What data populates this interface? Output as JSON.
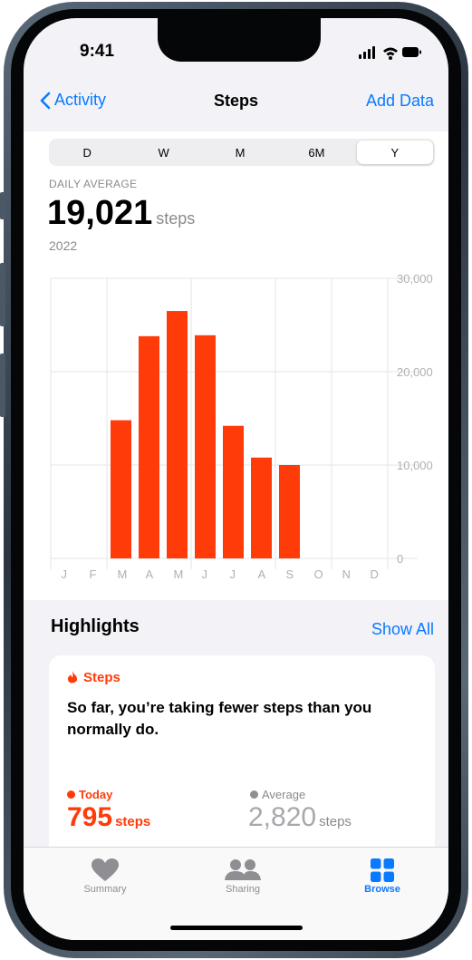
{
  "status_bar": {
    "time": "9:41"
  },
  "nav": {
    "back_label": "Activity",
    "title": "Steps",
    "add_label": "Add Data"
  },
  "segments": {
    "d": "D",
    "w": "W",
    "m": "M",
    "six_m": "6M",
    "y": "Y",
    "selected": "Y"
  },
  "summary": {
    "label": "DAILY AVERAGE",
    "value": "19,021",
    "unit": "steps",
    "period": "2022"
  },
  "chart_data": {
    "type": "bar",
    "categories": [
      "J",
      "F",
      "M",
      "A",
      "M",
      "J",
      "J",
      "A",
      "S",
      "O",
      "N",
      "D"
    ],
    "values": [
      0,
      0,
      14800,
      23800,
      26500,
      23900,
      14200,
      10800,
      10000,
      0,
      0,
      0
    ],
    "y_ticks": [
      "30,000",
      "20,000",
      "10,000",
      "0"
    ],
    "ylim": [
      0,
      30000
    ],
    "color": "#ff3b0a",
    "grid": true
  },
  "highlights": {
    "title": "Highlights",
    "show_all": "Show All",
    "card": {
      "category": "Steps",
      "text": "So far, you’re taking fewer steps than you normally do.",
      "today_label": "Today",
      "today_value": "795",
      "today_unit": "steps",
      "average_label": "Average",
      "average_value": "2,820",
      "average_unit": "steps"
    }
  },
  "tabbar": {
    "summary": "Summary",
    "sharing": "Sharing",
    "browse": "Browse",
    "selected": "Browse"
  },
  "colors": {
    "accent": "#0a7aff",
    "steps": "#ff3b0a"
  }
}
